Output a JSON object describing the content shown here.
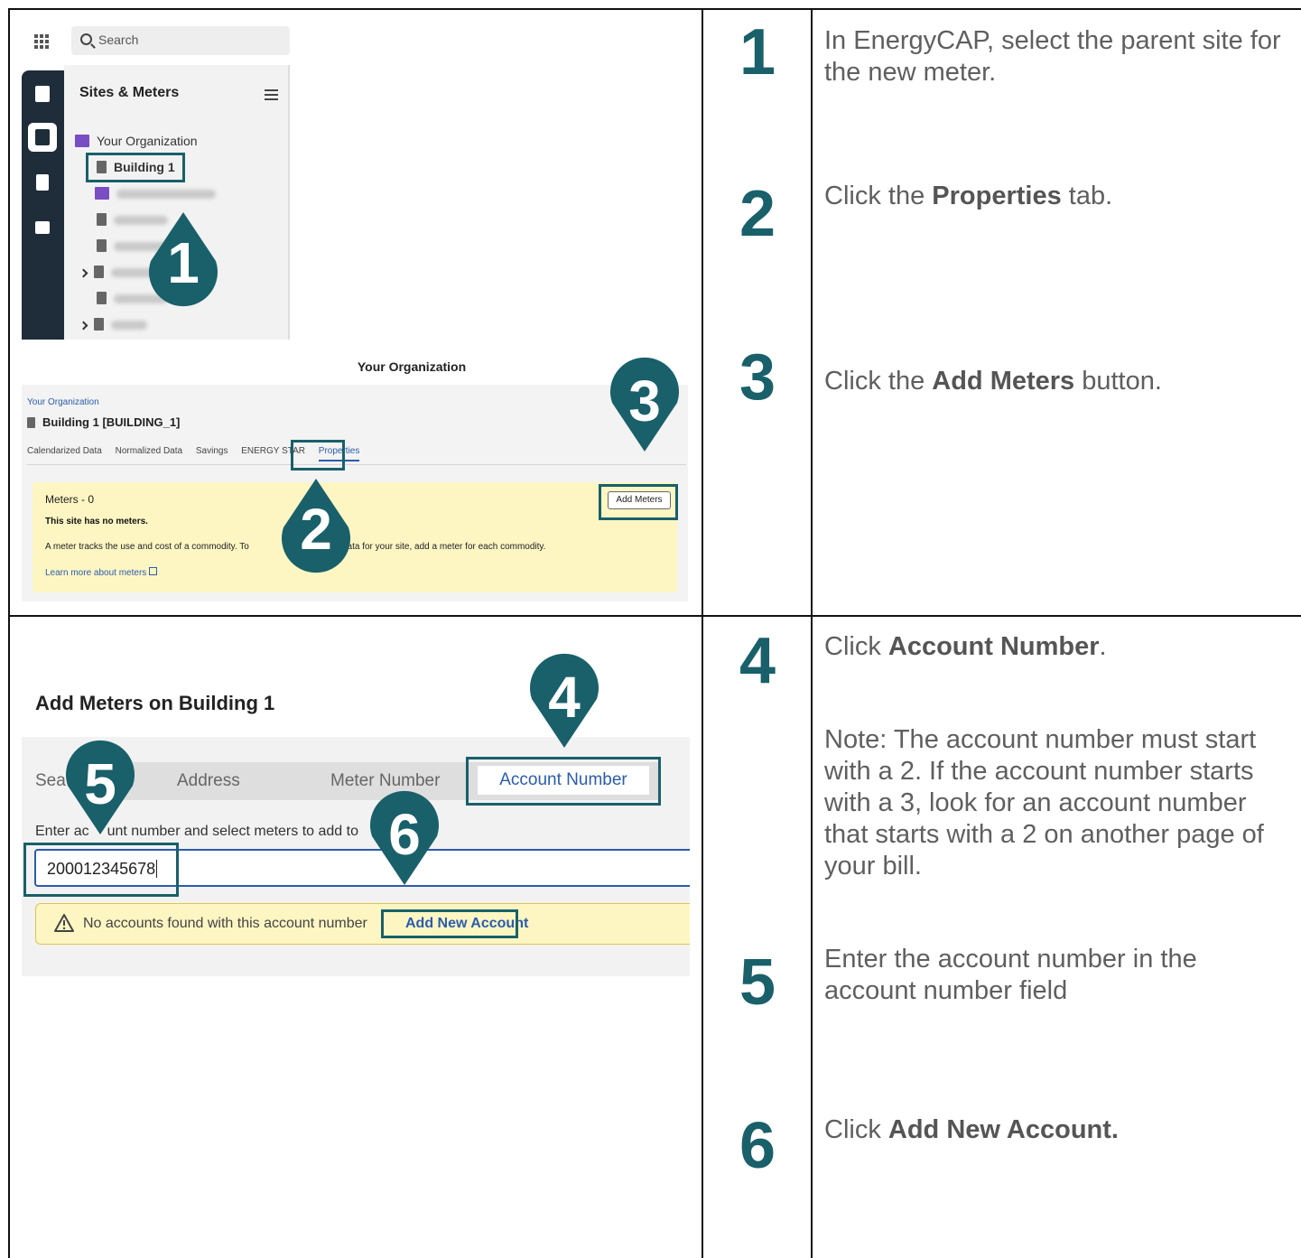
{
  "colors": {
    "accent": "#19606a",
    "link": "#2b5cab",
    "note_bg": "#fdf6c3"
  },
  "shot1": {
    "search_placeholder": "Search",
    "panel_title": "Sites & Meters",
    "org_label": "Your Organization",
    "building_label": "Building 1",
    "icons": [
      "apps-grid-icon",
      "search-icon",
      "menu-icon",
      "dashboard-icon",
      "buildings-icon",
      "calculator-icon",
      "list-icon"
    ]
  },
  "shot2": {
    "heading": "Your Organization",
    "breadcrumb": "Your Organization",
    "site_title": "Building 1 [BUILDING_1]",
    "tabs": [
      "Calendarized Data",
      "Normalized Data",
      "Savings",
      "ENERGY STAR",
      "Properties"
    ],
    "meters_count": "Meters - 0",
    "no_meters": "This site has no meters.",
    "info_left": "A meter tracks the use and cost of a commodity. To",
    "info_right": "ost data for your site, add a meter for each commodity.",
    "learn_more": "Learn more about meters",
    "add_meters_button": "Add Meters"
  },
  "shot3": {
    "heading": "Add Meters on Building 1",
    "tab_search": "Sea",
    "tab_address": "Address",
    "tab_meter_number": "Meter Number",
    "tab_account_number": "Account Number",
    "enter_label_a": "Enter ac",
    "enter_label_b": "unt number and select meters to add to",
    "input_value": "200012345678",
    "warning_text": "No accounts found with this account number",
    "add_new_account": "Add New Account"
  },
  "markers": [
    "1",
    "2",
    "3",
    "4",
    "5",
    "6"
  ],
  "steps": [
    {
      "num": "1",
      "text_plain": "In EnergyCAP, select the parent site for the new meter."
    },
    {
      "num": "2",
      "text_before": "Click the ",
      "text_bold": "Properties",
      "text_after": " tab."
    },
    {
      "num": "3",
      "text_before": "Click the ",
      "text_bold": "Add Meters",
      "text_after": " button."
    },
    {
      "num": "4",
      "text_before": "Click ",
      "text_bold": "Account Number",
      "text_after": "."
    },
    {
      "num": "5",
      "text_plain": "Enter the account number in the account number field"
    },
    {
      "num": "6",
      "text_before": "Click ",
      "text_bold": "Add New Account.",
      "text_after": ""
    }
  ],
  "note": "Note: The account number must start with a 2. If the account number starts with a 3, look for an account number that starts with a 2 on another page of your bill."
}
